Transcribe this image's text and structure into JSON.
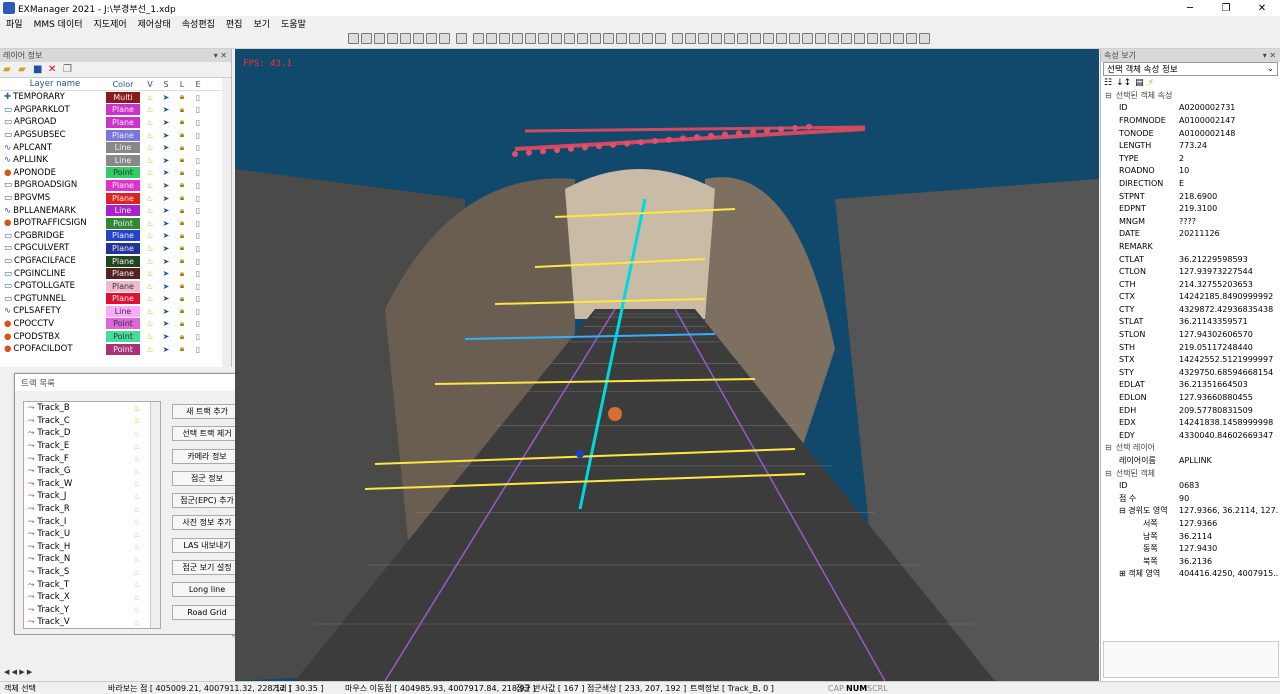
{
  "window": {
    "title": "EXManager 2021 - J:\\부경부선_1.xdp"
  },
  "menu": [
    "파일",
    "MMS 데이터",
    "지도제어",
    "제어상태",
    "속성편집",
    "편집",
    "보기",
    "도움말"
  ],
  "layer_panel": {
    "title": "레이어 정보",
    "headers": {
      "name": "Layer name",
      "color": "Color",
      "v": "V",
      "s": "S",
      "l": "L",
      "e": "E"
    },
    "layers": [
      {
        "name": "TEMPORARY",
        "type": "Multi",
        "color": "#8b1a1a"
      },
      {
        "name": "APGPARKLOT",
        "type": "Plane",
        "color": "#cc33cc"
      },
      {
        "name": "APGROAD",
        "type": "Plane",
        "color": "#cc33cc"
      },
      {
        "name": "APGSUBSEC",
        "type": "Plane",
        "color": "#7777dd"
      },
      {
        "name": "APLCANT",
        "type": "Line",
        "color": "#888888"
      },
      {
        "name": "APLLINK",
        "type": "Line",
        "color": "#888888"
      },
      {
        "name": "APONODE",
        "type": "Point",
        "color": "#33cc66"
      },
      {
        "name": "BPGROADSIGN",
        "type": "Plane",
        "color": "#dd33cc"
      },
      {
        "name": "BPGVMS",
        "type": "Plane",
        "color": "#dd2222"
      },
      {
        "name": "BPLLANEMARK",
        "type": "Line",
        "color": "#aa22cc"
      },
      {
        "name": "BPOTRAFFICSIGN",
        "type": "Point",
        "color": "#338833"
      },
      {
        "name": "CPGBRIDGE",
        "type": "Plane",
        "color": "#2244cc"
      },
      {
        "name": "CPGCULVERT",
        "type": "Plane",
        "color": "#223399"
      },
      {
        "name": "CPGFACILFACE",
        "type": "Plane",
        "color": "#224422"
      },
      {
        "name": "CPGINCLINE",
        "type": "Plane",
        "color": "#552222"
      },
      {
        "name": "CPGTOLLGATE",
        "type": "Plane",
        "color": "#eebbcc"
      },
      {
        "name": "CPGTUNNEL",
        "type": "Plane",
        "color": "#dd1133"
      },
      {
        "name": "CPLSAFETY",
        "type": "Line",
        "color": "#ffaaff"
      },
      {
        "name": "CPOCCTV",
        "type": "Point",
        "color": "#dd66dd"
      },
      {
        "name": "CPODSTBX",
        "type": "Point",
        "color": "#44dd99"
      },
      {
        "name": "CPOFACILDOT",
        "type": "Point",
        "color": "#aa3377"
      }
    ]
  },
  "track_dialog": {
    "title": "트랙 목록",
    "tracks": [
      "Track_B",
      "Track_C",
      "Track_D",
      "Track_E",
      "Track_F",
      "Track_G",
      "Track_W",
      "Track_J",
      "Track_R",
      "Track_I",
      "Track_U",
      "Track_H",
      "Track_N",
      "Track_S",
      "Track_T",
      "Track_X",
      "Track_Y",
      "Track_V"
    ],
    "buttons": [
      "새 트랙 추가",
      "선택 트랙 제거",
      "카메라 정보",
      "점군 정보",
      "점군(EPC) 추가",
      "사진 정보 추가",
      "LAS 내보내기",
      "점군 보기 설정",
      "Long line",
      "Road Grid"
    ]
  },
  "viewport": {
    "fps_label": "FPS: 43.1"
  },
  "properties": {
    "title": "속성 보기",
    "select": "선택 객체 속성 정보",
    "cat1": "선택된 객체 속성",
    "attrs": [
      [
        "ID",
        "A0200002731"
      ],
      [
        "FROMNODE",
        "A0100002147"
      ],
      [
        "TONODE",
        "A0100002148"
      ],
      [
        "LENGTH",
        "773.24"
      ],
      [
        "TYPE",
        "2"
      ],
      [
        "ROADNO",
        "10"
      ],
      [
        "DIRECTION",
        "E"
      ],
      [
        "STPNT",
        "218.6900"
      ],
      [
        "EDPNT",
        "219.3100"
      ],
      [
        "MNGM",
        "????"
      ],
      [
        "DATE",
        "20211126"
      ],
      [
        "REMARK",
        ""
      ],
      [
        "CTLAT",
        "36.21229598593"
      ],
      [
        "CTLON",
        "127.93973227544"
      ],
      [
        "CTH",
        "214.32755203653"
      ],
      [
        "CTX",
        "14242185.8490999992"
      ],
      [
        "CTY",
        "4329872.42936835438"
      ],
      [
        "STLAT",
        "36.21143359571"
      ],
      [
        "STLON",
        "127.94302606570"
      ],
      [
        "STH",
        "219.05117248440"
      ],
      [
        "STX",
        "14242552.5121999997"
      ],
      [
        "STY",
        "4329750.68594668154"
      ],
      [
        "EDLAT",
        "36.21351664503"
      ],
      [
        "EDLON",
        "127.93660880455"
      ],
      [
        "EDH",
        "209.57780831509"
      ],
      [
        "EDX",
        "14241838.1458999998"
      ],
      [
        "EDY",
        "4330040.84602669347"
      ]
    ],
    "cat2": "선택 레이어",
    "layer_key": "레이어이름",
    "layer_val": "APLLINK",
    "cat3": "선택된 객체",
    "obj": [
      [
        "ID",
        "0683"
      ],
      [
        "점 수",
        "90"
      ]
    ],
    "bbox_label": "경위도 영역",
    "bbox_val": "127.9366, 36.2114, 127....",
    "bbox": [
      [
        "서쪽",
        "127.9366"
      ],
      [
        "남쪽",
        "36.2114"
      ],
      [
        "동쪽",
        "127.9430"
      ],
      [
        "북쪽",
        "36.2136"
      ]
    ],
    "obj_area_label": "객체 영역",
    "obj_area_val": "404416.4250, 4007915...."
  },
  "status": {
    "mode": "객체 선택",
    "bottom_point": "바라보는 점 [ 405009.21, 4007911.32, 228.12 ]",
    "distance": "거리 [ 30.35 ]",
    "mouse": "마우스 이동점 [ 404985.93, 4007917.84, 218.93 ]",
    "reflect": "점군 반사값 [ 167 ]",
    "color": "점군색상 [ 233, 207, 192 ]",
    "track": "트랙정보 [ Track_B, 0 ]",
    "cap": "CAP",
    "num": "NUM",
    "scrl": "SCRL"
  },
  "colors": {
    "viewport_bg": "#10496b",
    "accent": "#2450a0"
  }
}
